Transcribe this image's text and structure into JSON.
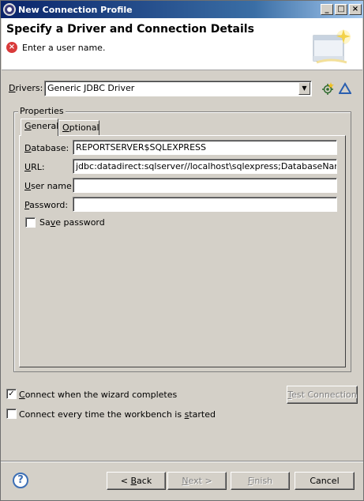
{
  "window": {
    "title": "New Connection Profile",
    "minimize": "_",
    "maximize": "□",
    "close": "×"
  },
  "header": {
    "title": "Specify a Driver and Connection Details",
    "message": "Enter a user name."
  },
  "drivers": {
    "label_pre": "",
    "label_u": "D",
    "label_post": "rivers:",
    "value": "Generic JDBC Driver"
  },
  "properties": {
    "group_label": "Properties",
    "tabs": [
      {
        "label_pre": "",
        "label_u": "G",
        "label_post": "eneral"
      },
      {
        "label_pre": "",
        "label_u": "O",
        "label_post": "ptional"
      }
    ],
    "fields": {
      "database": {
        "label_pre": "",
        "label_u": "D",
        "label_post": "atabase:",
        "value": "REPORTSERVER$SQLEXPRESS"
      },
      "url": {
        "label_pre": "",
        "label_u": "U",
        "label_post": "RL:",
        "value": "jdbc:datadirect:sqlserver//localhost\\sqlexpress;DatabaseName=Rep"
      },
      "user": {
        "label_pre": "",
        "label_u": "U",
        "label_post": "ser name:",
        "value": ""
      },
      "password": {
        "label_pre": "",
        "label_u": "P",
        "label_post": "assword:",
        "value": ""
      }
    },
    "save_password": {
      "label_pre": "Sa",
      "label_u": "v",
      "label_post": "e password",
      "checked": false
    }
  },
  "options": {
    "connect_wizard": {
      "label_pre": "",
      "label_u": "C",
      "label_post": "onnect when the wizard completes",
      "checked": true
    },
    "connect_startup": {
      "label_pre": "Connect every time the workbench is ",
      "label_u": "s",
      "label_post": "tarted",
      "checked": false
    },
    "test_connection": {
      "label_pre": "",
      "label_u": "T",
      "label_post": "est Connection"
    }
  },
  "buttons": {
    "back": {
      "pre": "< ",
      "u": "B",
      "post": "ack"
    },
    "next": {
      "pre": "",
      "u": "N",
      "post": "ext >"
    },
    "finish": {
      "pre": "",
      "u": "F",
      "post": "inish"
    },
    "cancel": {
      "label": "Cancel"
    }
  },
  "colors": {
    "titlebar_start": "#0a246a",
    "titlebar_end": "#a6caf0",
    "error": "#d93a3a",
    "face": "#d4d0c8"
  }
}
